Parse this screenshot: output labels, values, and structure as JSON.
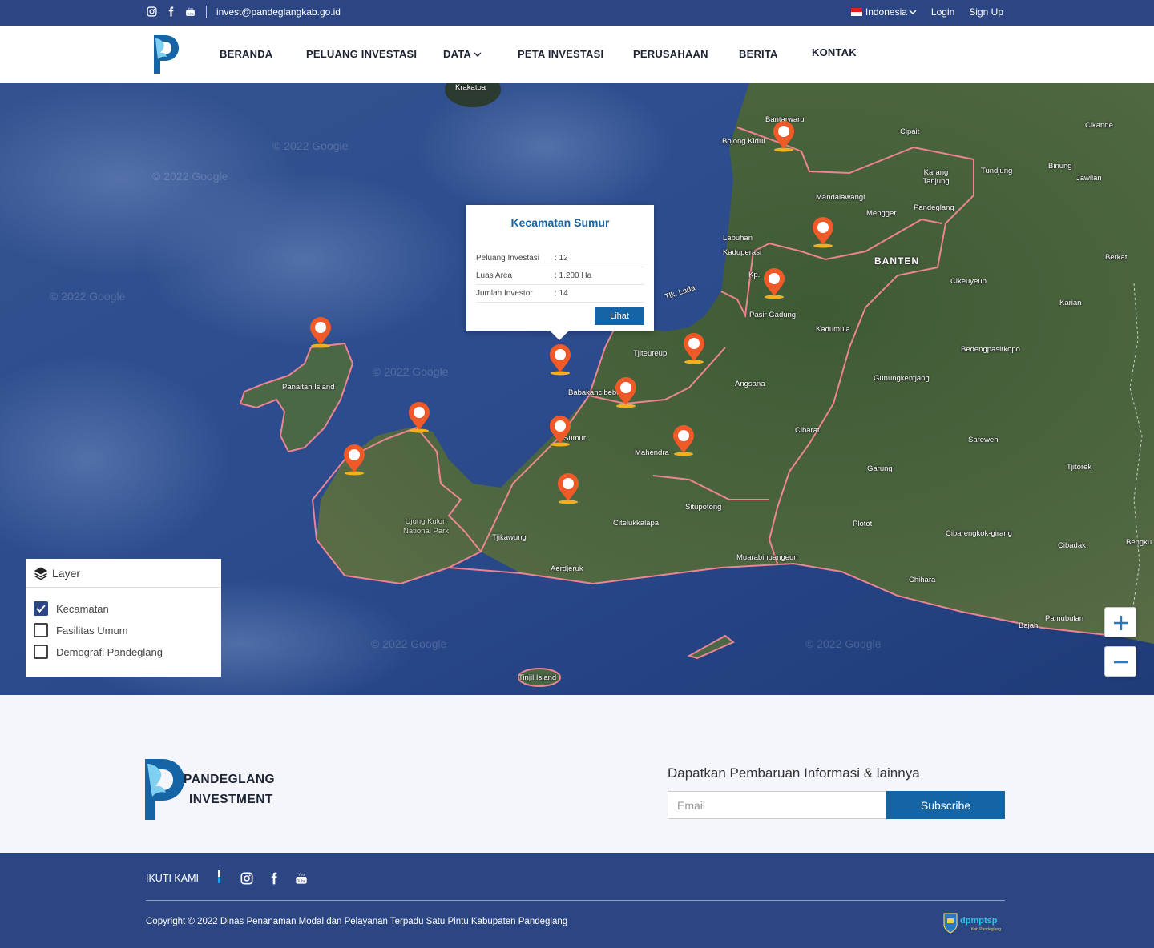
{
  "topbar": {
    "email": "invest@pandeglangkab.go.id",
    "language": "Indonesia",
    "login": "Login",
    "signup": "Sign Up"
  },
  "nav": {
    "items": [
      "BERANDA",
      "PELUANG INVESTASI",
      "DATA",
      "PETA INVESTASI",
      "PERUSAHAAN",
      "BERITA",
      "KONTAK"
    ]
  },
  "map": {
    "watermark": "© 2022 Google",
    "labels": [
      "Krakatoa",
      "Bantarwaru",
      "Bojong Kidul",
      "Cipait",
      "Cikande",
      "Binung",
      "Jawilan",
      "Tundjung",
      "Karang Tanjung",
      "Mandalawangi",
      "Mengger",
      "Pandeglang",
      "Labuhan",
      "Kaduperasi",
      "BANTEN",
      "Berkat",
      "Cikeuyeup",
      "Kp.",
      "Tlk. Lada",
      "Pasir Gadung",
      "Karian",
      "Kadumula",
      "Bedengpasirkopo",
      "Tjiteureup",
      "Panaitan Island",
      "Babakancibeber",
      "Angsana",
      "Gunungkentjang",
      "Mahendra",
      "Sumur",
      "Cibarat",
      "Sareweh",
      "Garung",
      "Tjitorek",
      "Situpotong",
      "Ujung Kulon National Park",
      "Citelukkalapa",
      "Tjikawung",
      "Plotot",
      "Cibarengkok-girang",
      "Bengku",
      "Cibadak",
      "Muarabinuangeun",
      "Aerdjeruk",
      "Chihara",
      "Pamubulan",
      "Bajah",
      "Tinjil Island"
    ],
    "popup": {
      "title": "Kecamatan Sumur",
      "rows": [
        {
          "label": "Peluang Investasi",
          "value": ": 12"
        },
        {
          "label": "Luas Area",
          "value": ": 1.200 Ha"
        },
        {
          "label": "Jumlah Investor",
          "value": ": 14"
        }
      ],
      "button": "Lihat"
    },
    "layer_panel": {
      "title": "Layer",
      "items": [
        {
          "label": "Kecamatan",
          "checked": true
        },
        {
          "label": "Fasilitas Umum",
          "checked": false
        },
        {
          "label": "Demografi Pandeglang",
          "checked": false
        }
      ]
    },
    "zoom_in": "+",
    "zoom_out": "−"
  },
  "newsletter": {
    "brand_line1": "PANDEGLANG",
    "brand_line2": "INVESTMENT",
    "title": "Dapatkan Pembaruan Informasi & lainnya",
    "email_placeholder": "Email",
    "subscribe": "Subscribe"
  },
  "footer": {
    "follow": "IKUTI KAMI",
    "copyright": "Copyright © 2022 Dinas Penanaman Modal dan Pelayanan Terpadu Satu Pintu Kabupaten Pandeglang",
    "dpm_logo_text": "dpmptsp Kab.Pandeglang"
  },
  "colors": {
    "primary": "#2b4682",
    "accent": "#1565a6",
    "marker": "#f05a28"
  },
  "icons": [
    "instagram-icon",
    "facebook-icon",
    "youtube-icon",
    "chevron-down-icon",
    "layers-icon",
    "check-icon",
    "map-marker-icon",
    "plus-icon",
    "minus-icon"
  ]
}
